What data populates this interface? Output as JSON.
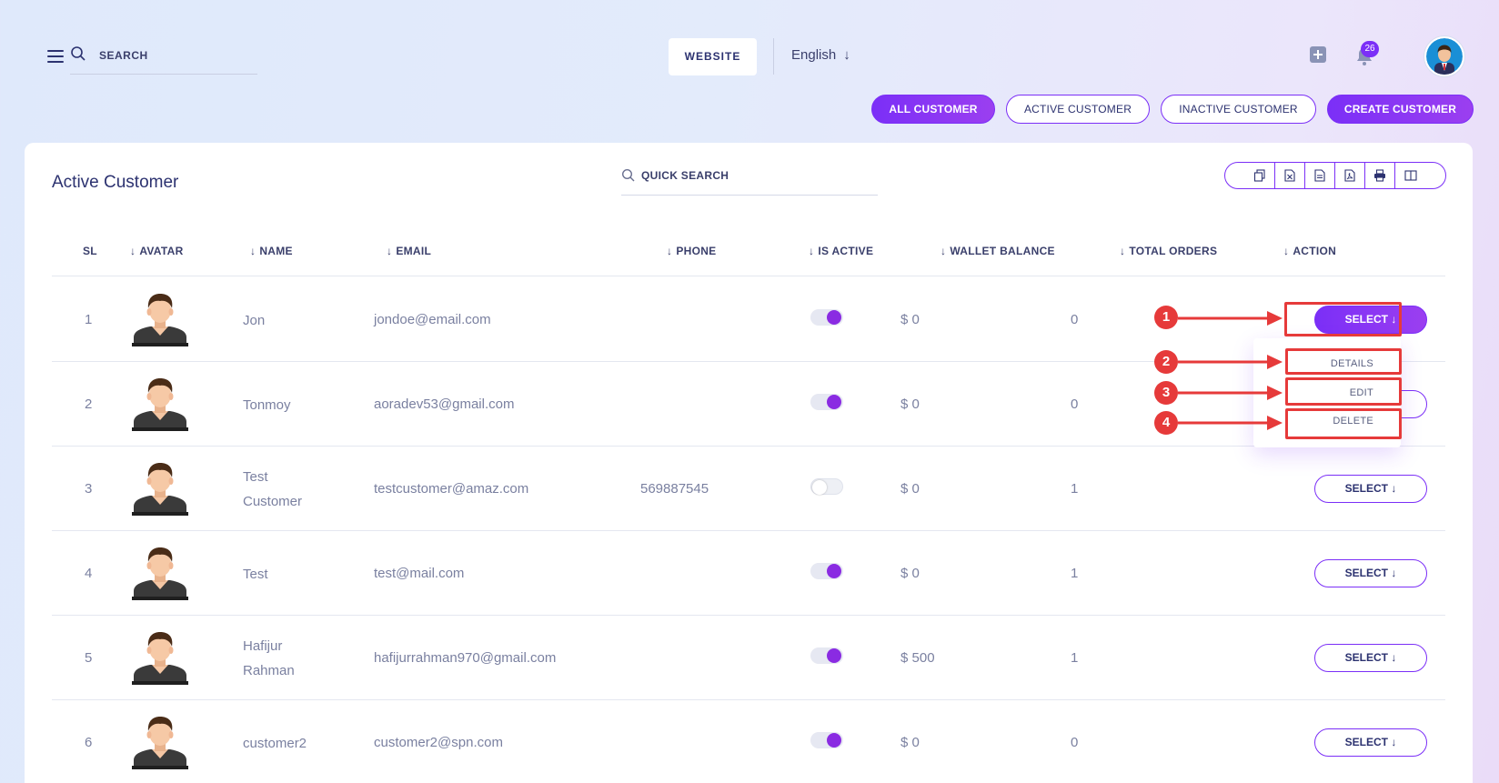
{
  "header": {
    "search_placeholder": "SEARCH",
    "website_label": "WEBSITE",
    "language": "English",
    "notification_count": "26"
  },
  "filters": {
    "all": "ALL CUSTOMER",
    "active": "ACTIVE CUSTOMER",
    "inactive": "INACTIVE CUSTOMER",
    "create": "CREATE CUSTOMER"
  },
  "card": {
    "title": "Active Customer",
    "quick_search": "QUICK SEARCH"
  },
  "table": {
    "headers": {
      "sl": "SL",
      "avatar": "AVATAR",
      "name": "NAME",
      "email": "EMAIL",
      "phone": "PHONE",
      "is_active": "IS ACTIVE",
      "wallet": "WALLET BALANCE",
      "orders": "TOTAL ORDERS",
      "action": "ACTION"
    },
    "rows": [
      {
        "sl": "1",
        "name": "Jon",
        "name2": "",
        "email": "jondoe@email.com",
        "phone": "",
        "active": true,
        "wallet": "$ 0",
        "orders": "0",
        "action": "SELECT"
      },
      {
        "sl": "2",
        "name": "Tonmoy",
        "name2": "",
        "email": "aoradev53@gmail.com",
        "phone": "",
        "active": true,
        "wallet": "$ 0",
        "orders": "0",
        "action": "SELECT"
      },
      {
        "sl": "3",
        "name": "Test",
        "name2": "Customer",
        "email": "testcustomer@amaz.com",
        "phone": "569887545",
        "active": false,
        "wallet": "$ 0",
        "orders": "1",
        "action": "SELECT"
      },
      {
        "sl": "4",
        "name": "Test",
        "name2": "",
        "email": "test@mail.com",
        "phone": "",
        "active": true,
        "wallet": "$ 0",
        "orders": "1",
        "action": "SELECT"
      },
      {
        "sl": "5",
        "name": "Hafijur",
        "name2": "Rahman",
        "email": "hafijurrahman970@gmail.com",
        "phone": "",
        "active": true,
        "wallet": "$ 500",
        "orders": "1",
        "action": "SELECT"
      },
      {
        "sl": "6",
        "name": "customer2",
        "name2": "",
        "email": "customer2@spn.com",
        "phone": "",
        "active": true,
        "wallet": "$ 0",
        "orders": "0",
        "action": "SELECT"
      }
    ]
  },
  "dropdown": {
    "details": "DETAILS",
    "edit": "EDIT",
    "delete": "DELETE"
  },
  "annotations": [
    "1",
    "2",
    "3",
    "4"
  ],
  "colors": {
    "accent": "#7b2ff7",
    "annotation": "#e63a3a"
  }
}
